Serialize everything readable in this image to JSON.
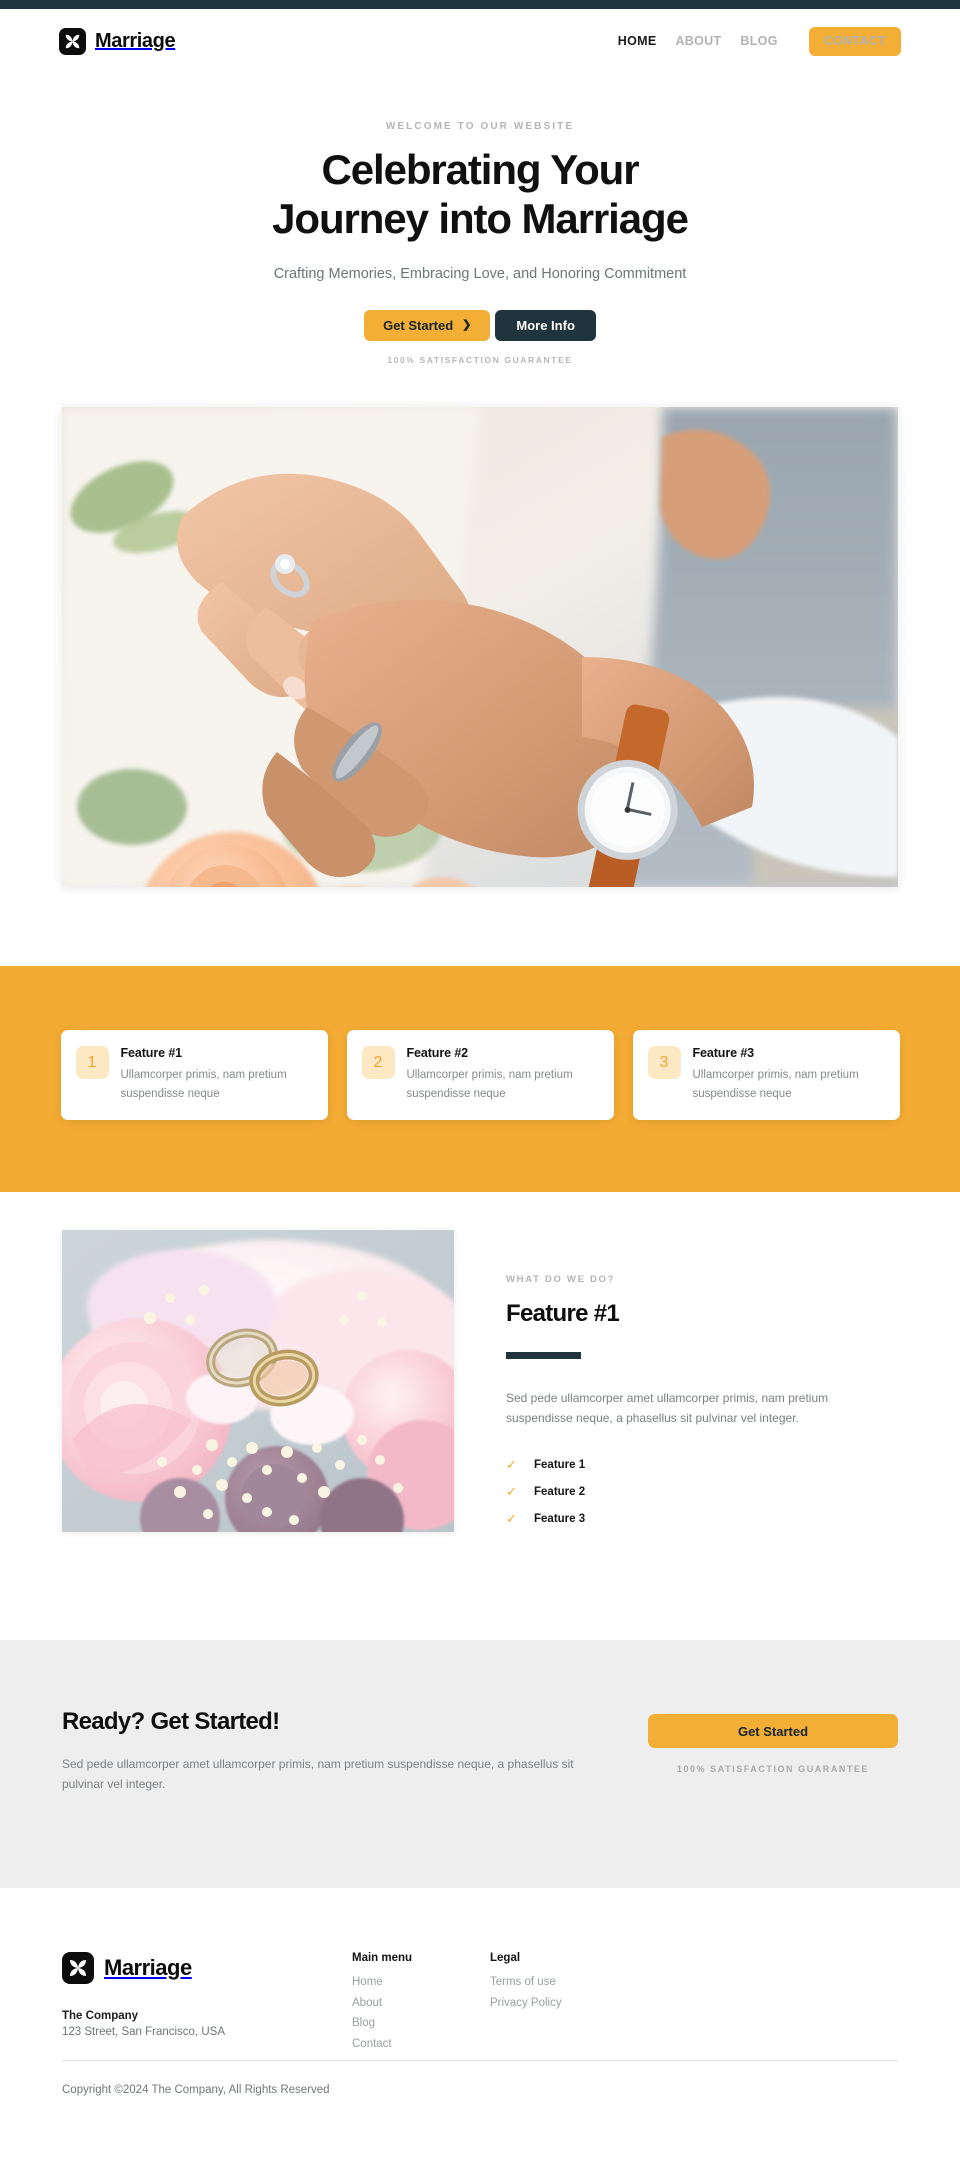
{
  "colors": {
    "accent": "#f3ae35",
    "accent_band": "#f3ab33",
    "dark": "#20343d",
    "topstrip": "#1f3640",
    "num_badge_bg": "#fde8c4",
    "num_badge_text": "#f0a32d",
    "cta_band": "#eeeeee",
    "muted_text": "#7c8083"
  },
  "header": {
    "brand": "Marriage",
    "logo_icon": "pinwheel-logo-icon",
    "nav": [
      {
        "label": "HOME",
        "active": true
      },
      {
        "label": "ABOUT",
        "active": false
      },
      {
        "label": "BLOG",
        "active": false
      }
    ],
    "contact_label": "CONTACT"
  },
  "hero": {
    "eyebrow": "WELCOME TO OUR WEBSITE",
    "title_line1": "Celebrating Your",
    "title_line2": "Journey into Marriage",
    "subtitle": "Crafting Memories, Embracing Love, and Honoring Commitment",
    "primary_button": "Get Started",
    "primary_button_icon": "chevron-right-icon",
    "secondary_button": "More Info",
    "guarantee": "100% SATISFACTION GUARANTEE",
    "image_alt": "couple-hands-with-rings-photo"
  },
  "features_band": {
    "cards": [
      {
        "number": "1",
        "title": "Feature #1",
        "text": "Ullamcorper primis, nam pretium suspendisse neque"
      },
      {
        "number": "2",
        "title": "Feature #2",
        "text": "Ullamcorper primis, nam pretium suspendisse neque"
      },
      {
        "number": "3",
        "title": "Feature #3",
        "text": "Ullamcorper primis, nam pretium suspendisse neque"
      }
    ]
  },
  "what_we_do": {
    "image_alt": "wedding-rings-on-flowers-photo",
    "eyebrow": "WHAT DO WE DO?",
    "title": "Feature #1",
    "paragraph": "Sed pede ullamcorper amet ullamcorper primis, nam pretium suspendisse neque, a phasellus sit pulvinar vel integer.",
    "checklist": [
      {
        "icon": "check-icon",
        "label": "Feature 1"
      },
      {
        "icon": "check-icon",
        "label": "Feature 2"
      },
      {
        "icon": "check-icon",
        "label": "Feature 3"
      }
    ]
  },
  "cta": {
    "title": "Ready? Get Started!",
    "paragraph": "Sed pede ullamcorper amet ullamcorper primis, nam pretium suspendisse neque, a phasellus sit pulvinar vel integer.",
    "button": "Get Started",
    "guarantee": "100% SATISFACTION GUARANTEE"
  },
  "footer": {
    "brand": "Marriage",
    "logo_icon": "pinwheel-logo-icon",
    "company": "The Company",
    "address": "123 Street, San Francisco, USA",
    "columns": [
      {
        "heading": "Main menu",
        "links": [
          {
            "label": "Home"
          },
          {
            "label": "About"
          },
          {
            "label": "Blog"
          },
          {
            "label": "Contact"
          }
        ]
      },
      {
        "heading": "Legal",
        "links": [
          {
            "label": "Terms of use"
          },
          {
            "label": "Privacy Policy"
          }
        ]
      }
    ],
    "copyright": "Copyright ©2024 The Company, All Rights Reserved"
  }
}
